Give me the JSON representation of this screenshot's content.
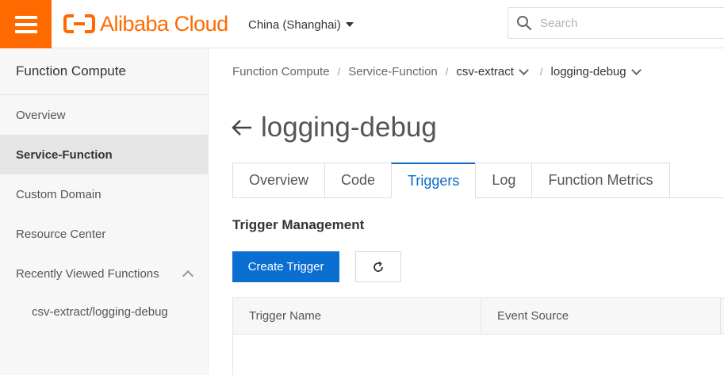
{
  "header": {
    "logo_text": "Alibaba Cloud",
    "region": "China (Shanghai)",
    "search_placeholder": "Search",
    "brand_color": "#ff6a00"
  },
  "sidebar": {
    "title": "Function Compute",
    "items": [
      {
        "label": "Overview"
      },
      {
        "label": "Service-Function"
      },
      {
        "label": "Custom Domain"
      },
      {
        "label": "Resource Center"
      },
      {
        "label": "Recently Viewed Functions"
      },
      {
        "label": "csv-extract/logging-debug"
      }
    ]
  },
  "breadcrumb": {
    "items": [
      "Function Compute",
      "Service-Function",
      "csv-extract",
      "logging-debug"
    ],
    "separator": "/"
  },
  "page": {
    "title": "logging-debug"
  },
  "tabs": [
    {
      "label": "Overview"
    },
    {
      "label": "Code"
    },
    {
      "label": "Triggers"
    },
    {
      "label": "Log"
    },
    {
      "label": "Function Metrics"
    }
  ],
  "active_tab": "Triggers",
  "trigger_management": {
    "title": "Trigger Management",
    "create_button": "Create Trigger",
    "columns": [
      "Trigger Name",
      "Event Source"
    ]
  },
  "colors": {
    "accent": "#0a68c8",
    "primary_button": "#0a6fd1"
  }
}
